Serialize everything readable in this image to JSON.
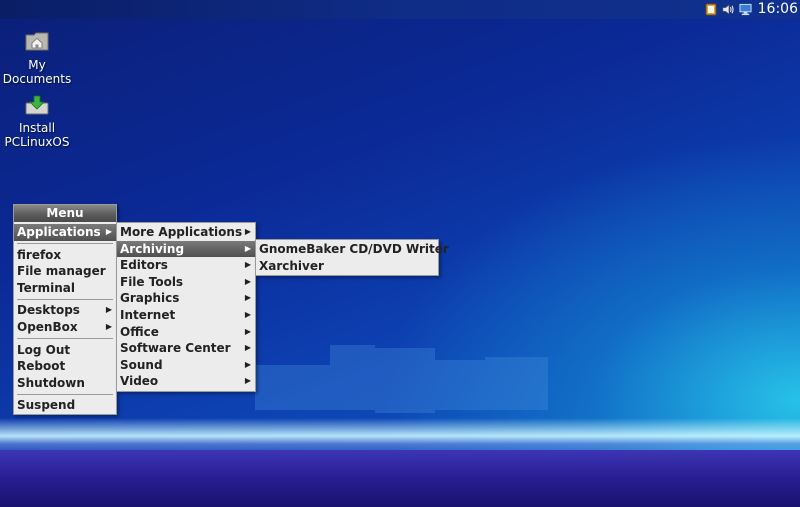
{
  "desktop": {
    "icons": [
      {
        "label_line1": "My",
        "label_line2": "Documents",
        "icon": "home-folder-icon"
      },
      {
        "label_line1": "Install",
        "label_line2": "PCLinuxOS",
        "icon": "install-icon"
      }
    ]
  },
  "taskbar": {
    "clock": "16:06",
    "tray_icons": [
      "clipboard-icon",
      "volume-icon",
      "network-icon"
    ]
  },
  "main_menu": {
    "title": "Menu",
    "items": [
      {
        "label": "Applications",
        "submenu": true,
        "selected": true
      },
      {
        "label": "firefox"
      },
      {
        "label": "File manager"
      },
      {
        "label": "Terminal"
      },
      {
        "label": "Desktops",
        "submenu": true
      },
      {
        "label": "OpenBox",
        "submenu": true
      },
      {
        "label": "Log Out"
      },
      {
        "label": "Reboot"
      },
      {
        "label": "Shutdown"
      },
      {
        "label": "Suspend"
      }
    ]
  },
  "applications_menu": {
    "items": [
      {
        "label": "More Applications",
        "submenu": true
      },
      {
        "label": "Archiving",
        "submenu": true,
        "selected": true
      },
      {
        "label": "Editors",
        "submenu": true
      },
      {
        "label": "File Tools",
        "submenu": true
      },
      {
        "label": "Graphics",
        "submenu": true
      },
      {
        "label": "Internet",
        "submenu": true
      },
      {
        "label": "Office",
        "submenu": true
      },
      {
        "label": "Software Center",
        "submenu": true
      },
      {
        "label": "Sound",
        "submenu": true
      },
      {
        "label": "Video",
        "submenu": true
      }
    ]
  },
  "archiving_menu": {
    "items": [
      {
        "label": "GnomeBaker CD/DVD Writer"
      },
      {
        "label": "Xarchiver"
      }
    ]
  },
  "colors": {
    "menu_bg": "#ececec",
    "selected_bg": "#5a5a5a",
    "desktop_blue": "#0d3fb0"
  }
}
